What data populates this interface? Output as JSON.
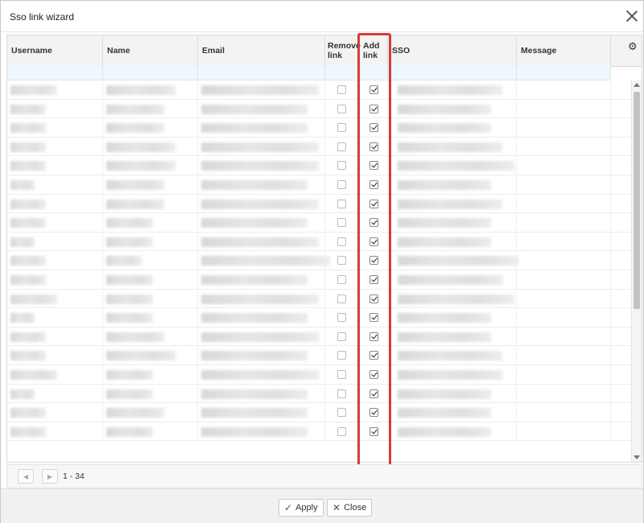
{
  "dialog": {
    "title": "Sso link wizard"
  },
  "columns": [
    {
      "key": "username",
      "label": "Username"
    },
    {
      "key": "name",
      "label": "Name"
    },
    {
      "key": "email",
      "label": "Email"
    },
    {
      "key": "remove_link",
      "label": "Remove link"
    },
    {
      "key": "add_link",
      "label": "Add link"
    },
    {
      "key": "sso",
      "label": "SSO"
    },
    {
      "key": "message",
      "label": "Message"
    }
  ],
  "rows": {
    "count": 19,
    "remove_link_checked": [
      false,
      false,
      false,
      false,
      false,
      false,
      false,
      false,
      false,
      false,
      false,
      false,
      false,
      false,
      false,
      false,
      false,
      false,
      false
    ],
    "add_link_checked": [
      true,
      true,
      true,
      true,
      true,
      true,
      true,
      true,
      true,
      true,
      true,
      true,
      true,
      true,
      true,
      true,
      true,
      true,
      true
    ]
  },
  "pager": {
    "range_text": "1 - 34"
  },
  "footer": {
    "apply_label": "Apply",
    "close_label": "Close"
  },
  "icons": {
    "settings": "gear-icon",
    "close": "close-icon",
    "apply": "check-icon",
    "close_btn": "x-icon",
    "prev": "prev-page-icon",
    "next": "next-page-icon"
  },
  "colors": {
    "highlight": "#d83b3b",
    "filter_row": "#eef7fc"
  }
}
